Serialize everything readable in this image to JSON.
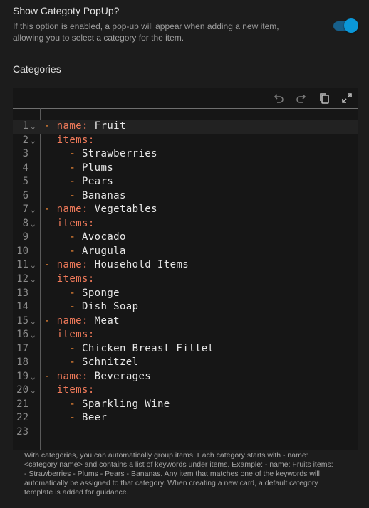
{
  "toggle": {
    "title": "Show Categoty PopUp?",
    "description": "If this option is enabled, a pop-up will appear when adding a new item, allowing you to select a category for the item.",
    "enabled": true,
    "accent_color": "#0a97d8"
  },
  "categories_label": "Categories",
  "toolbar": {
    "undo_icon": "undo-icon",
    "redo_icon": "redo-icon",
    "copy_icon": "copy-icon",
    "fullscreen_icon": "fullscreen-icon"
  },
  "editor": {
    "active_line": 1,
    "lines": [
      {
        "n": "1",
        "fold": true,
        "indent": "",
        "dash": "- ",
        "key": "name",
        "sep": ": ",
        "value": "Fruit"
      },
      {
        "n": "2",
        "fold": true,
        "indent": "  ",
        "dash": "",
        "key": "items",
        "sep": ":",
        "value": ""
      },
      {
        "n": "3",
        "fold": false,
        "indent": "    ",
        "dash": "- ",
        "key": "",
        "sep": "",
        "value": "Strawberries"
      },
      {
        "n": "4",
        "fold": false,
        "indent": "    ",
        "dash": "- ",
        "key": "",
        "sep": "",
        "value": "Plums"
      },
      {
        "n": "5",
        "fold": false,
        "indent": "    ",
        "dash": "- ",
        "key": "",
        "sep": "",
        "value": "Pears"
      },
      {
        "n": "6",
        "fold": false,
        "indent": "    ",
        "dash": "- ",
        "key": "",
        "sep": "",
        "value": "Bananas"
      },
      {
        "n": "7",
        "fold": true,
        "indent": "",
        "dash": "- ",
        "key": "name",
        "sep": ": ",
        "value": "Vegetables"
      },
      {
        "n": "8",
        "fold": true,
        "indent": "  ",
        "dash": "",
        "key": "items",
        "sep": ":",
        "value": ""
      },
      {
        "n": "9",
        "fold": false,
        "indent": "    ",
        "dash": "- ",
        "key": "",
        "sep": "",
        "value": "Avocado"
      },
      {
        "n": "10",
        "fold": false,
        "indent": "    ",
        "dash": "- ",
        "key": "",
        "sep": "",
        "value": "Arugula"
      },
      {
        "n": "11",
        "fold": true,
        "indent": "",
        "dash": "- ",
        "key": "name",
        "sep": ": ",
        "value": "Household Items"
      },
      {
        "n": "12",
        "fold": true,
        "indent": "  ",
        "dash": "",
        "key": "items",
        "sep": ":",
        "value": ""
      },
      {
        "n": "13",
        "fold": false,
        "indent": "    ",
        "dash": "- ",
        "key": "",
        "sep": "",
        "value": "Sponge"
      },
      {
        "n": "14",
        "fold": false,
        "indent": "    ",
        "dash": "- ",
        "key": "",
        "sep": "",
        "value": "Dish Soap"
      },
      {
        "n": "15",
        "fold": true,
        "indent": "",
        "dash": "- ",
        "key": "name",
        "sep": ": ",
        "value": "Meat"
      },
      {
        "n": "16",
        "fold": true,
        "indent": "  ",
        "dash": "",
        "key": "items",
        "sep": ":",
        "value": ""
      },
      {
        "n": "17",
        "fold": false,
        "indent": "    ",
        "dash": "- ",
        "key": "",
        "sep": "",
        "value": "Chicken Breast Fillet"
      },
      {
        "n": "18",
        "fold": false,
        "indent": "    ",
        "dash": "- ",
        "key": "",
        "sep": "",
        "value": "Schnitzel"
      },
      {
        "n": "19",
        "fold": true,
        "indent": "",
        "dash": "- ",
        "key": "name",
        "sep": ": ",
        "value": "Beverages"
      },
      {
        "n": "20",
        "fold": true,
        "indent": "  ",
        "dash": "",
        "key": "items",
        "sep": ":",
        "value": ""
      },
      {
        "n": "21",
        "fold": false,
        "indent": "    ",
        "dash": "- ",
        "key": "",
        "sep": "",
        "value": "Sparkling Wine"
      },
      {
        "n": "22",
        "fold": false,
        "indent": "    ",
        "dash": "- ",
        "key": "",
        "sep": "",
        "value": "Beer"
      },
      {
        "n": "23",
        "fold": false,
        "indent": "",
        "dash": "",
        "key": "",
        "sep": "",
        "value": ""
      }
    ]
  },
  "helper_text": "With categories, you can automatically group items. Each category starts with - name: <category name> and contains a list of keywords under items. Example: - name: Fruits items: - Strawberries - Plums - Pears - Bananas. Any item that matches one of the keywords will automatically be assigned to that category. When creating a new card, a default category template is added for guidance."
}
